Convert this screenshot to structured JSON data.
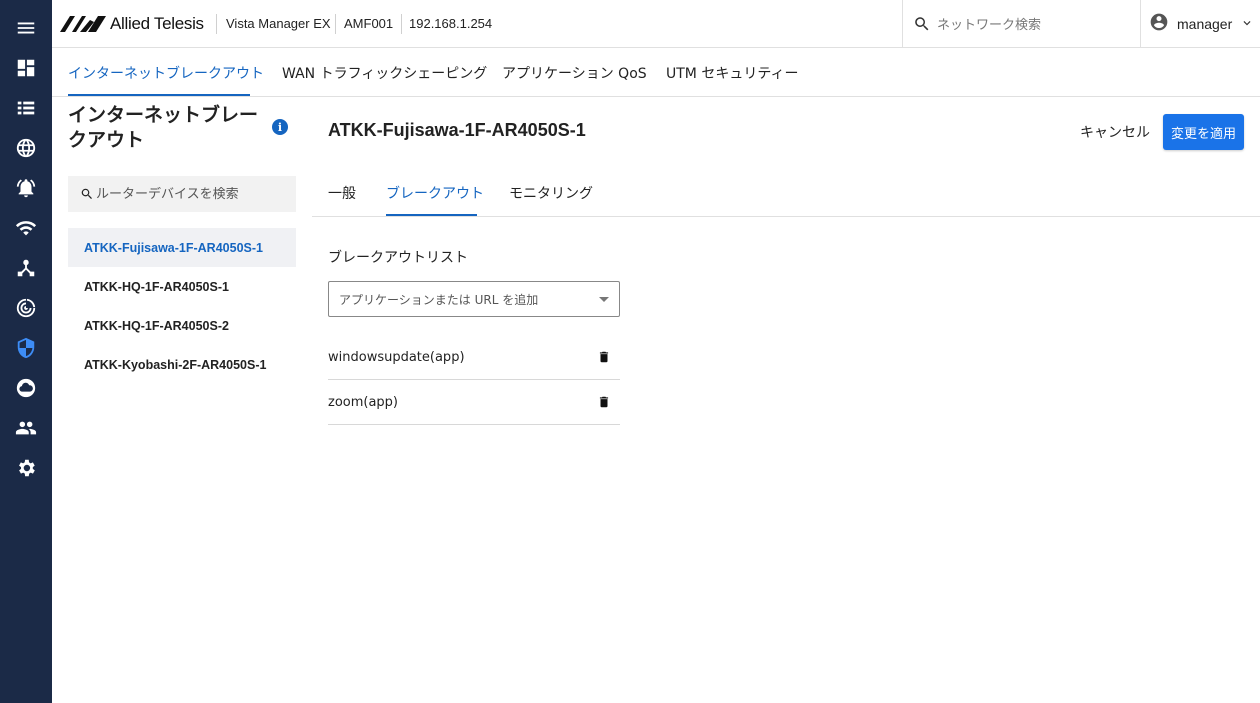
{
  "header": {
    "logo_text": "Allied Telesis",
    "product": "Vista Manager EX",
    "area": "AMF001",
    "ip": "192.168.1.254",
    "search_placeholder": "ネットワーク検索",
    "user": "manager"
  },
  "rail": {
    "icons": [
      "menu-icon",
      "dashboard-icon",
      "list-icon",
      "globe-icon",
      "alarm-icon",
      "wifi-icon",
      "topology-icon",
      "radar-icon",
      "shield-icon",
      "cloud-icon",
      "users-icon",
      "gear-icon"
    ],
    "active": "shield-icon"
  },
  "top_tabs": [
    {
      "label": "インターネットブレークアウト",
      "active": true
    },
    {
      "label": "WAN トラフィックシェーピング",
      "active": false
    },
    {
      "label": "アプリケーション QoS",
      "active": false
    },
    {
      "label": "UTM セキュリティー",
      "active": false
    }
  ],
  "left_panel": {
    "title": "インターネットブレークアウト",
    "info_glyph": "i",
    "search_placeholder": "ルーターデバイスを検索",
    "devices": [
      {
        "name": "ATKK-Fujisawa-1F-AR4050S-1",
        "active": true
      },
      {
        "name": "ATKK-HQ-1F-AR4050S-1",
        "active": false
      },
      {
        "name": "ATKK-HQ-1F-AR4050S-2",
        "active": false
      },
      {
        "name": "ATKK-Kyobashi-2F-AR4050S-1",
        "active": false
      }
    ]
  },
  "main": {
    "title": "ATKK-Fujisawa-1F-AR4050S-1",
    "cancel_label": "キャンセル",
    "apply_label": "変更を適用",
    "sub_tabs": [
      {
        "label": "一般",
        "active": false
      },
      {
        "label": "ブレークアウト",
        "active": true
      },
      {
        "label": "モニタリング",
        "active": false
      }
    ],
    "section_label": "ブレークアウトリスト",
    "add_placeholder": "アプリケーションまたは URL を追加",
    "breakout_items": [
      {
        "name": "windowsupdate(app)"
      },
      {
        "name": "zoom(app)"
      }
    ]
  },
  "colors": {
    "rail_bg": "#1b2a47",
    "accent": "#1565c0",
    "apply_button": "#1a73e8"
  }
}
